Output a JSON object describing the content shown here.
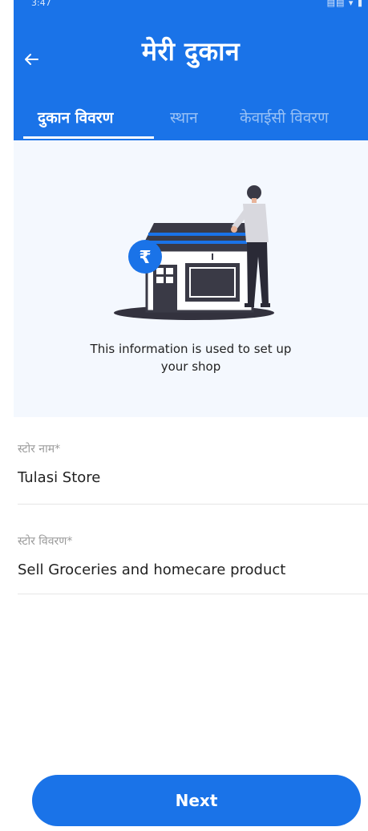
{
  "status_bar": {
    "time": "3:47",
    "icons": "▤▤ ▾ ▮"
  },
  "header": {
    "title": "मेरी दुकान",
    "back_icon": "arrow-left-icon"
  },
  "tabs": [
    {
      "label": "दुकान विवरण",
      "active": true
    },
    {
      "label": "स्थान",
      "active": false
    },
    {
      "label": "केवाईसी विवरण",
      "active": false
    }
  ],
  "hero": {
    "illustration_badge": "₹",
    "caption_line1": "This information is used to set up",
    "caption_line2": "your shop"
  },
  "form": {
    "store_name": {
      "label": "स्टोर नाम*",
      "value": "Tulasi Store"
    },
    "store_description": {
      "label": "स्टोर विवरण*",
      "value": "Sell Groceries and homecare product"
    }
  },
  "footer": {
    "next_label": "Next"
  },
  "colors": {
    "primary": "#1a73e8",
    "hero_background": "#f4f8fe",
    "label_gray": "#9a9a9a"
  }
}
